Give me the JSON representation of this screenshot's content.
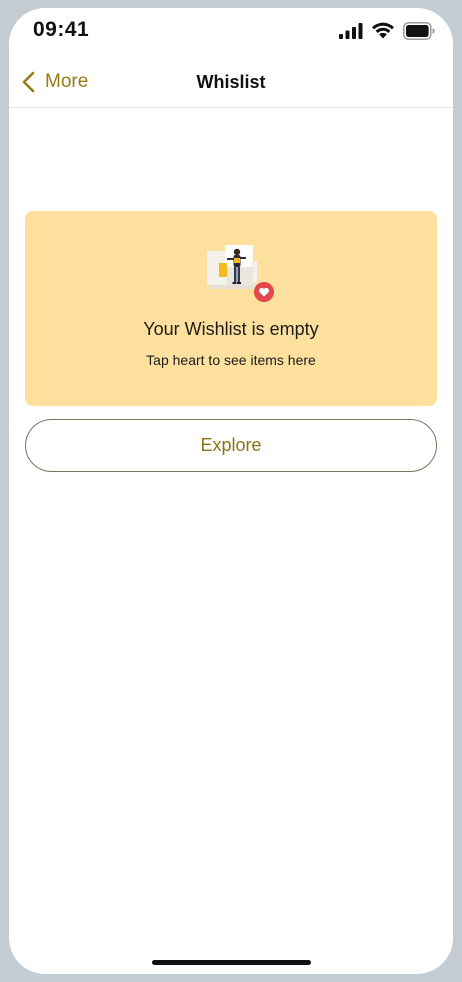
{
  "status_bar": {
    "time": "09:41"
  },
  "nav": {
    "back_label": "More",
    "title": "Whislist"
  },
  "empty_state": {
    "title": "Your Wishlist is empty",
    "subtitle": "Tap heart to see items here"
  },
  "actions": {
    "explore_label": "Explore"
  },
  "colors": {
    "accent": "#9a7b12",
    "card_background": "#fde09d",
    "heart_badge": "#e2474b"
  },
  "icons": {
    "back": "chevron-left-icon",
    "signal": "cellular-signal-icon",
    "wifi": "wifi-icon",
    "battery": "battery-icon",
    "illustration": "person-wishlist-illustration",
    "heart": "heart-icon"
  }
}
